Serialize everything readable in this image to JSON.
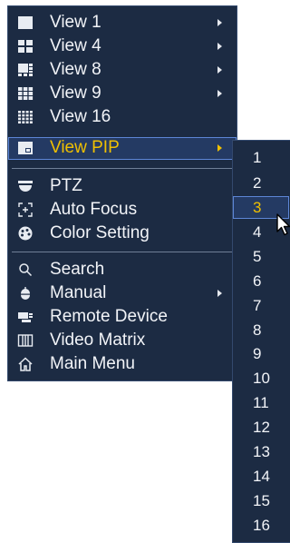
{
  "colors": {
    "menu_bg": "#1c2b43",
    "text": "#f2f4f8",
    "highlight_text": "#f0c000",
    "selection_border": "#5d86d6"
  },
  "menu": {
    "items": [
      {
        "label": "View 1",
        "icon": "single-view-icon",
        "has_submenu": true
      },
      {
        "label": "View 4",
        "icon": "quad-view-icon",
        "has_submenu": true
      },
      {
        "label": "View 8",
        "icon": "eight-view-icon",
        "has_submenu": true
      },
      {
        "label": "View 9",
        "icon": "nine-view-icon",
        "has_submenu": true
      },
      {
        "label": "View 16",
        "icon": "sixteen-view-icon",
        "has_submenu": false
      },
      {
        "label": "View PIP",
        "icon": "pip-view-icon",
        "has_submenu": true,
        "selected": true
      },
      {
        "label": "PTZ",
        "icon": "ptz-camera-icon",
        "has_submenu": false
      },
      {
        "label": "Auto Focus",
        "icon": "auto-focus-icon",
        "has_submenu": false
      },
      {
        "label": "Color Setting",
        "icon": "palette-icon",
        "has_submenu": false
      },
      {
        "label": "Search",
        "icon": "search-icon",
        "has_submenu": false
      },
      {
        "label": "Manual",
        "icon": "record-icon",
        "has_submenu": true
      },
      {
        "label": "Remote Device",
        "icon": "remote-device-icon",
        "has_submenu": false
      },
      {
        "label": "Video Matrix",
        "icon": "video-matrix-icon",
        "has_submenu": false
      },
      {
        "label": "Main Menu",
        "icon": "home-icon",
        "has_submenu": false
      }
    ]
  },
  "submenu": {
    "items": [
      "1",
      "2",
      "3",
      "4",
      "5",
      "6",
      "7",
      "8",
      "9",
      "10",
      "11",
      "12",
      "13",
      "14",
      "15",
      "16"
    ],
    "selected": "3"
  }
}
